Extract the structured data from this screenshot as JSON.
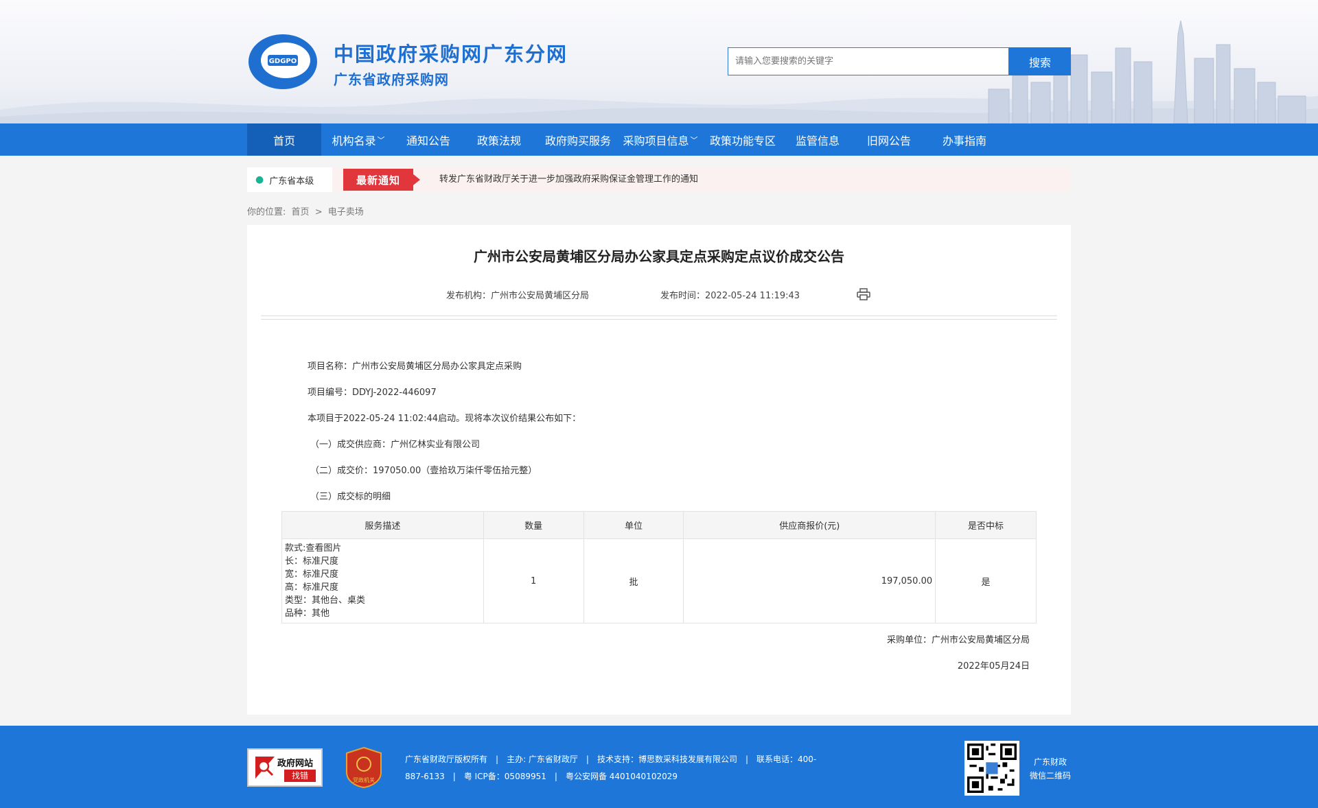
{
  "header": {
    "logo_text": "GDGPO",
    "title": "中国政府采购网广东分网",
    "subtitle": "广东省政府采购网",
    "search_placeholder": "请输入您要搜索的关键字",
    "search_button": "搜索"
  },
  "nav": {
    "items": [
      {
        "label": "首页",
        "dropdown": false,
        "active": true
      },
      {
        "label": "机构名录",
        "dropdown": true
      },
      {
        "label": "通知公告",
        "dropdown": false
      },
      {
        "label": "政策法规",
        "dropdown": false
      },
      {
        "label": "政府购买服务",
        "dropdown": false
      },
      {
        "label": "采购项目信息",
        "dropdown": true
      },
      {
        "label": "政策功能专区",
        "dropdown": false
      },
      {
        "label": "监管信息",
        "dropdown": false
      },
      {
        "label": "旧网公告",
        "dropdown": false
      },
      {
        "label": "办事指南",
        "dropdown": false
      }
    ],
    "chevron": "﹀"
  },
  "notice": {
    "location": "广东省本级",
    "badge": "最新通知",
    "text": "转发广东省财政厅关于进一步加强政府采购保证金管理工作的通知"
  },
  "breadcrumb": {
    "prefix": "你的位置:",
    "home": "首页",
    "sep": ">",
    "current": "电子卖场"
  },
  "article": {
    "title": "广州市公安局黄埔区分局办公家具定点采购定点议价成交公告",
    "publisher": "发布机构：广州市公安局黄埔区分局",
    "publish_time": "发布时间：2022-05-24 11:19:43",
    "project_name": "项目名称：广州市公安局黄埔区分局办公家具定点采购",
    "project_no": "项目编号：DDYJ-2022-446097",
    "intro": "本项目于2022-05-24 11:02:44启动。现将本次议价结果公布如下：",
    "supplier": "（一）成交供应商：广州亿林实业有限公司",
    "price": "（二）成交价：197050.00（壹拾玖万柒仟零伍拾元整）",
    "detail_heading": "（三）成交标的明细",
    "table": {
      "headers": [
        "服务描述",
        "数量",
        "单位",
        "供应商报价(元)",
        "是否中标"
      ],
      "row": {
        "desc": [
          "款式:查看图片",
          "长：标准尺度",
          "宽：标准尺度",
          "高：标准尺度",
          "类型：其他台、桌类",
          "品种：其他"
        ],
        "qty": "1",
        "unit": "批",
        "price": "197,050.00",
        "won": "是"
      }
    },
    "buyer": "采购单位：广州市公安局黄埔区分局",
    "date": "2022年05月24日"
  },
  "footer": {
    "zc_line1": "政府网站",
    "zc_line2": "找错",
    "badge_text": "党政机关",
    "copyright": "广东省财政厅版权所有",
    "host": "主办: 广东省财政厅",
    "tech": "技术支持：博思数采科技发展有限公司",
    "phone": "联系电话：400-",
    "phone2": "887-6133",
    "icp": "粤 ICP备：05089951",
    "police": "粤公安网备 4401040102029",
    "qr_label1": "广东财政",
    "qr_label2": "微信二维码"
  },
  "colors": {
    "primary": "#1e77d8",
    "nav_active": "#1460b8",
    "badge_red": "#e0363c"
  }
}
